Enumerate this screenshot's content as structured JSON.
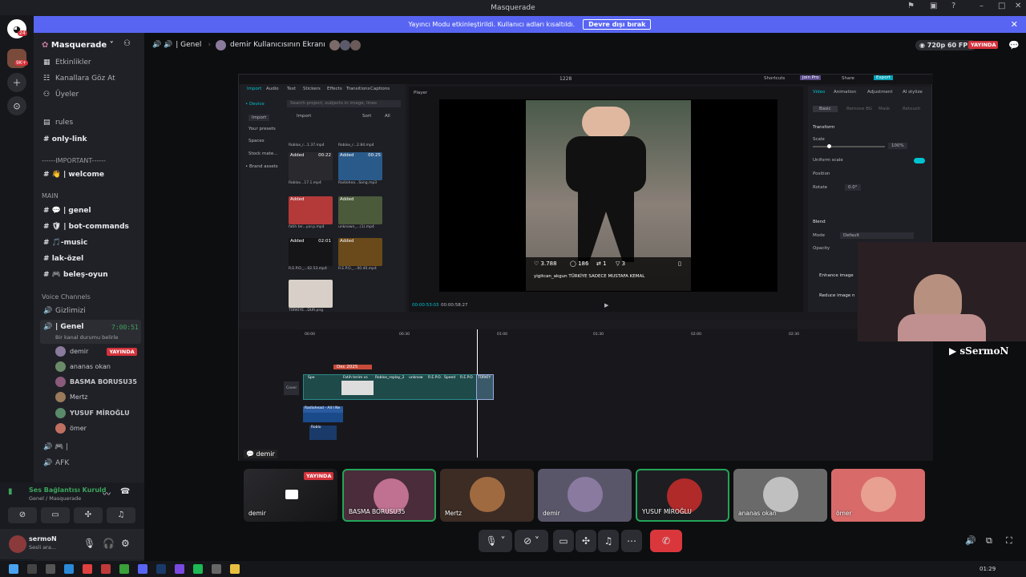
{
  "window": {
    "title": "Masquerade"
  },
  "banner": {
    "text": "Yayıncı Modu etkinleştirildi. Kullanıcı adları kısaltıldı.",
    "button": "Devre dışı bırak"
  },
  "guild": {
    "badge_top": "24",
    "badge_count": "9K+"
  },
  "server": {
    "name": "Masquerade"
  },
  "menu": [
    "Etkinlikler",
    "Kanallara Göz At",
    "Üyeler"
  ],
  "channels": {
    "rules": "rules",
    "only_link": "only-link",
    "important": "------IMPORTANT------",
    "welcome": "| welcome",
    "main": "MAIN",
    "genel": "| genel",
    "bot": "| bot-commands",
    "music": "-music",
    "lak": "lak-özel",
    "beles": "beleş-oyun",
    "voice": "Voice Channels",
    "gizlimizi": "Gizlimizi",
    "genel_voice": "| Genel",
    "timer": "7:00:51",
    "status": "Bir kanal durumu belirle",
    "afk": "AFK",
    "pipe": "|"
  },
  "voice_users": [
    {
      "name": "demir",
      "live": "YAYINDA",
      "color": "#8a7a9c"
    },
    {
      "name": "ananas okan",
      "color": "#6b8a6a"
    },
    {
      "name": "BASMA BORUSU35",
      "color": "#8a5a7a"
    },
    {
      "name": "Mertz",
      "color": "#9a7a5a"
    },
    {
      "name": "YUSUF MİROĞLU",
      "color": "#5a8a6a"
    },
    {
      "name": "ömer",
      "color": "#c07060"
    }
  ],
  "voicebar": {
    "title": "Ses Bağlantısı Kuruld",
    "sub": "Genel / Masquerade"
  },
  "userbar": {
    "name": "sermoN",
    "status": "Sesli ara..."
  },
  "header": {
    "channel": "| Genel",
    "screen": "demir Kullanıcısının Ekranı",
    "quality": "720p 60 FPS",
    "live": "YAYINDA"
  },
  "capcut": {
    "tabs": [
      "Import",
      "Audio",
      "Text",
      "Stickers",
      "Effects",
      "Transitions",
      "Captions"
    ],
    "side": [
      "• Device",
      "Import",
      "Your presets",
      "Spaces",
      "Stock mate...",
      "• Brand assets"
    ],
    "search": "Search project, subjects in image, lines",
    "import_btn": "Import",
    "sort": "Sort",
    "all": "All",
    "player_label": "Player",
    "ratio": "1228",
    "shortcuts": "Shortcuts",
    "join_pro": "Join Pro",
    "share": "Share",
    "export": "Export",
    "time_cur": "00:00:53:03",
    "time_total": "00:00:58:27",
    "right_tabs": [
      "Video",
      "Animation",
      "Adjustment",
      "AI stylize"
    ],
    "right_sub": [
      "Basic",
      "Remove BG",
      "Mask",
      "Retouch"
    ],
    "props": [
      "Transform",
      "Scale",
      "100%",
      "Uniform scale",
      "Position",
      "Rotate",
      "0.0°",
      "Blend",
      "Mode",
      "Default",
      "Opacity",
      "Enhance image",
      "Reduce image n"
    ],
    "video_stats": [
      "3.788",
      "186",
      "1",
      "3"
    ],
    "video_caption": "yigitcan_akgun TÜRKİYE SADECE MUSTAFA KEMAL",
    "clips": [
      "Added",
      "Added",
      "Added",
      "Added",
      "Added",
      "Added"
    ],
    "clip_names": [
      "Roblox_r...1.37.mp4",
      "Roblox_r...2.84.mp4",
      "Roblox...17.1.mp4",
      "Radiohea...Song.mp3",
      "fatih ter...yor.p.mp4",
      "unknown_...(1).mp4",
      "R.E.P.O._...02.53.mp4",
      "R.E.P.O._...00.40.mp4",
      "TÜRKİYE...DUR.png"
    ],
    "durations": [
      "00:22",
      "00:25",
      "02:01"
    ],
    "timeline_ticks": [
      "00:00",
      "00:30",
      "01:00",
      "01:30",
      "02:00",
      "02:30"
    ],
    "track_label": "Dec 2025",
    "audio_clip": "Radiohead - All I Ne",
    "cover": "Cover",
    "track_clips": [
      "Spe",
      "Fatih terim vs",
      "Roblox_replay_2",
      "unknow",
      "R.E.P.O.",
      "Speed",
      "R.E.P.O.",
      "TÜRKİY"
    ],
    "roblo": "Roblo"
  },
  "streamer_tag": "demir",
  "webcam_name": "sSermoN",
  "stage": [
    {
      "name": "demir",
      "live": "YAYINDA"
    },
    {
      "name": "BASMA BORUSU35",
      "color": "#4a2c3a",
      "face": "#c07090"
    },
    {
      "name": "Mertz",
      "color": "#3c2c24",
      "face": "#a06a40"
    },
    {
      "name": "demir",
      "color": "#5a566a",
      "face": "#8a7aa0"
    },
    {
      "name": "YUSUF MİROĞLU",
      "color": "#1e1e22",
      "face": "#b02a2a"
    },
    {
      "name": "ananas okan",
      "color": "#6a6a6a",
      "face": "#c0c0c0"
    },
    {
      "name": "ömer",
      "color": "#d86a6a",
      "face": "#e8a090"
    }
  ],
  "clock": "01:29",
  "colors": {
    "blurple": "#5865f2",
    "live": "#d4323b",
    "green": "#23a559",
    "capcut_accent": "#00c3d0"
  }
}
